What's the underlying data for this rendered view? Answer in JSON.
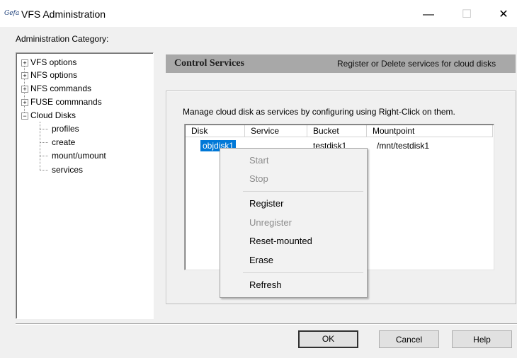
{
  "window": {
    "icon_text": "Gefa",
    "title": "VFS Administration",
    "minimize_glyph": "—",
    "maximize_glyph": "☐",
    "close_glyph": "✕"
  },
  "category_label": "Administration Category:",
  "tree": {
    "items": [
      {
        "label": "VFS options",
        "expander": "+"
      },
      {
        "label": "NFS options",
        "expander": "+"
      },
      {
        "label": "NFS commands",
        "expander": "+"
      },
      {
        "label": "FUSE commnands",
        "expander": "+"
      },
      {
        "label": "Cloud Disks",
        "expander": "−"
      }
    ],
    "children": [
      {
        "label": "profiles"
      },
      {
        "label": "create"
      },
      {
        "label": "mount/umount"
      },
      {
        "label": "services"
      }
    ]
  },
  "panel": {
    "title": "Control Services",
    "description": "Register or Delete services for cloud disks",
    "instruction": "Manage cloud disk as services by configuring using Right-Click on them."
  },
  "table": {
    "columns": [
      "Disk",
      "Service",
      "Bucket",
      "Mountpoint"
    ],
    "rows": [
      {
        "disk": "objdisk1",
        "service": "",
        "bucket": "testdisk1",
        "mountpoint": "/mnt/testdisk1"
      }
    ]
  },
  "context_menu": {
    "items": [
      {
        "label": "Start",
        "enabled": false
      },
      {
        "label": "Stop",
        "enabled": false
      },
      {
        "label": "Register",
        "enabled": true
      },
      {
        "label": "Unregister",
        "enabled": false
      },
      {
        "label": "Reset-mounted",
        "enabled": true
      },
      {
        "label": "Erase",
        "enabled": true
      },
      {
        "label": "Refresh",
        "enabled": true
      }
    ]
  },
  "buttons": {
    "ok": "OK",
    "cancel": "Cancel",
    "help": "Help"
  },
  "colors": {
    "selection": "#0078d7",
    "header_bar": "#a8a8a8",
    "dialog_bg": "#f0f0f0"
  }
}
